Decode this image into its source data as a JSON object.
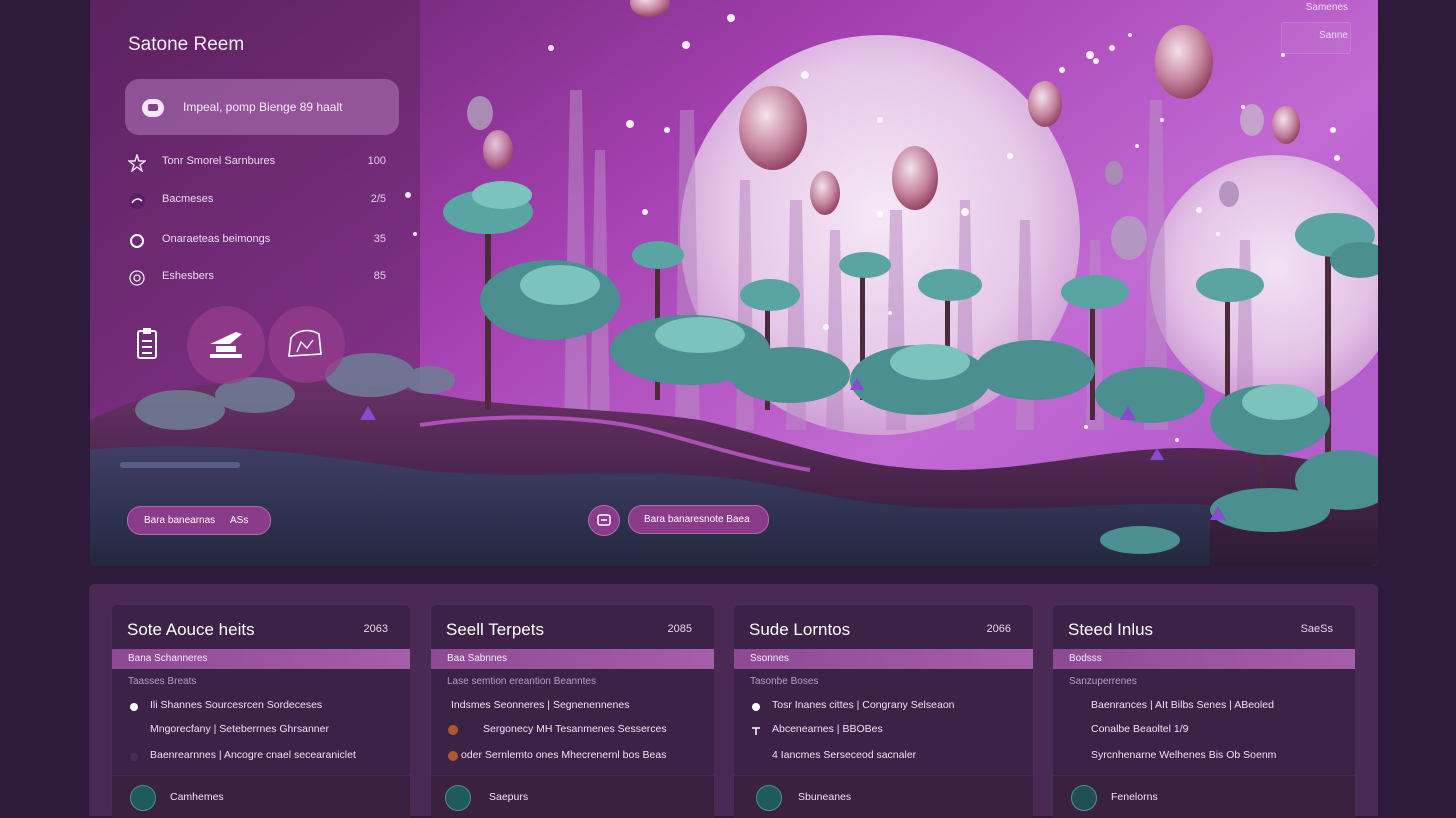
{
  "app": {
    "title": "Satone Reem"
  },
  "header_tabs": [
    "Samenes",
    "Sanne"
  ],
  "search": {
    "text": "Impeal, pomp Bienge 89 haalt"
  },
  "menu": [
    {
      "icon": "star-icon",
      "label": "Tonr Smorel Sarnbures",
      "value": "100"
    },
    {
      "icon": "paint-icon",
      "label": "Bacmeses",
      "value": "2/5"
    },
    {
      "icon": "ring-icon",
      "label": "Onaraeteas beimongs",
      "value": "35"
    },
    {
      "icon": "target-icon",
      "label": "Eshesbers",
      "value": "85"
    }
  ],
  "tools": [
    "clipboard-icon",
    "airplane-icon",
    "map-icon"
  ],
  "hero_buttons": {
    "left_label": "Bara banearnas",
    "left_value": "ASs",
    "right_label": "Bara banaresnote Baea"
  },
  "colors": {
    "accent": "#8a3c8a",
    "teal": "#4f9a9a",
    "background": "#2e1a3a"
  },
  "cards": [
    {
      "title": "Sote Aouce heits",
      "count": "2063",
      "band": "Bana Schanneres",
      "sub": "Taasses Breats",
      "rows": [
        {
          "icon": "dot-icon",
          "text": "Ili Shannes Sourcesrcen Sordeceses"
        },
        {
          "icon": "none",
          "text": "Mngorecfany  |  Seteberrnes Ghrsanner"
        },
        {
          "icon": "none",
          "text": "Baenrearnnes  |  Ancogre cnael secearaniclet"
        }
      ],
      "footer": {
        "icon": "globe-icon",
        "label": "Camhemes"
      }
    },
    {
      "title": "Seell Terpets",
      "count": "2085",
      "band": "Baa Sabnnes",
      "sub": "Lase semtion ereantion Beanntes",
      "rows": [
        {
          "icon": "none",
          "text": "Indsmes Seonneres  |  Segnenennenes"
        },
        {
          "icon": "blob-icon",
          "text": "Sergonecy  MH Tesanmenes Sesserces"
        },
        {
          "icon": "blob-icon",
          "text": "oder Sernlemto ones Mhecrenernl bos Beas"
        }
      ],
      "footer": {
        "icon": "f-icon",
        "label": "Saepurs"
      }
    },
    {
      "title": "Sude Lorntos",
      "count": "2066",
      "band": "Ssonnes",
      "sub": "Tasonbe Boses",
      "rows": [
        {
          "icon": "dot-icon",
          "text": "Tosr Inanes cittes  |  Congrany Selseaon"
        },
        {
          "icon": "arrow-icon",
          "text": "Abcenearnes  |  BBOBes"
        },
        {
          "icon": "none",
          "text": "4 Iancmes Serseceod sacnaler"
        }
      ],
      "footer": {
        "icon": "tooth-icon",
        "label": "Sbuneanes"
      }
    },
    {
      "title": "Steed Inlus",
      "count": "SaeSs",
      "band": "Bodsss",
      "sub": "Sanzuperrenes",
      "rows": [
        {
          "icon": "none",
          "text": "Baenrances  |  AIt Bilbs Senes  |  ABeoled"
        },
        {
          "icon": "none",
          "text": "Conalbe Beaoltel 1/9"
        },
        {
          "icon": "none",
          "text": "Syrcnhenarne Welhenes Bis Ob Soenm"
        }
      ],
      "footer": {
        "icon": "check-icon",
        "label": "Fenelorns"
      }
    }
  ]
}
